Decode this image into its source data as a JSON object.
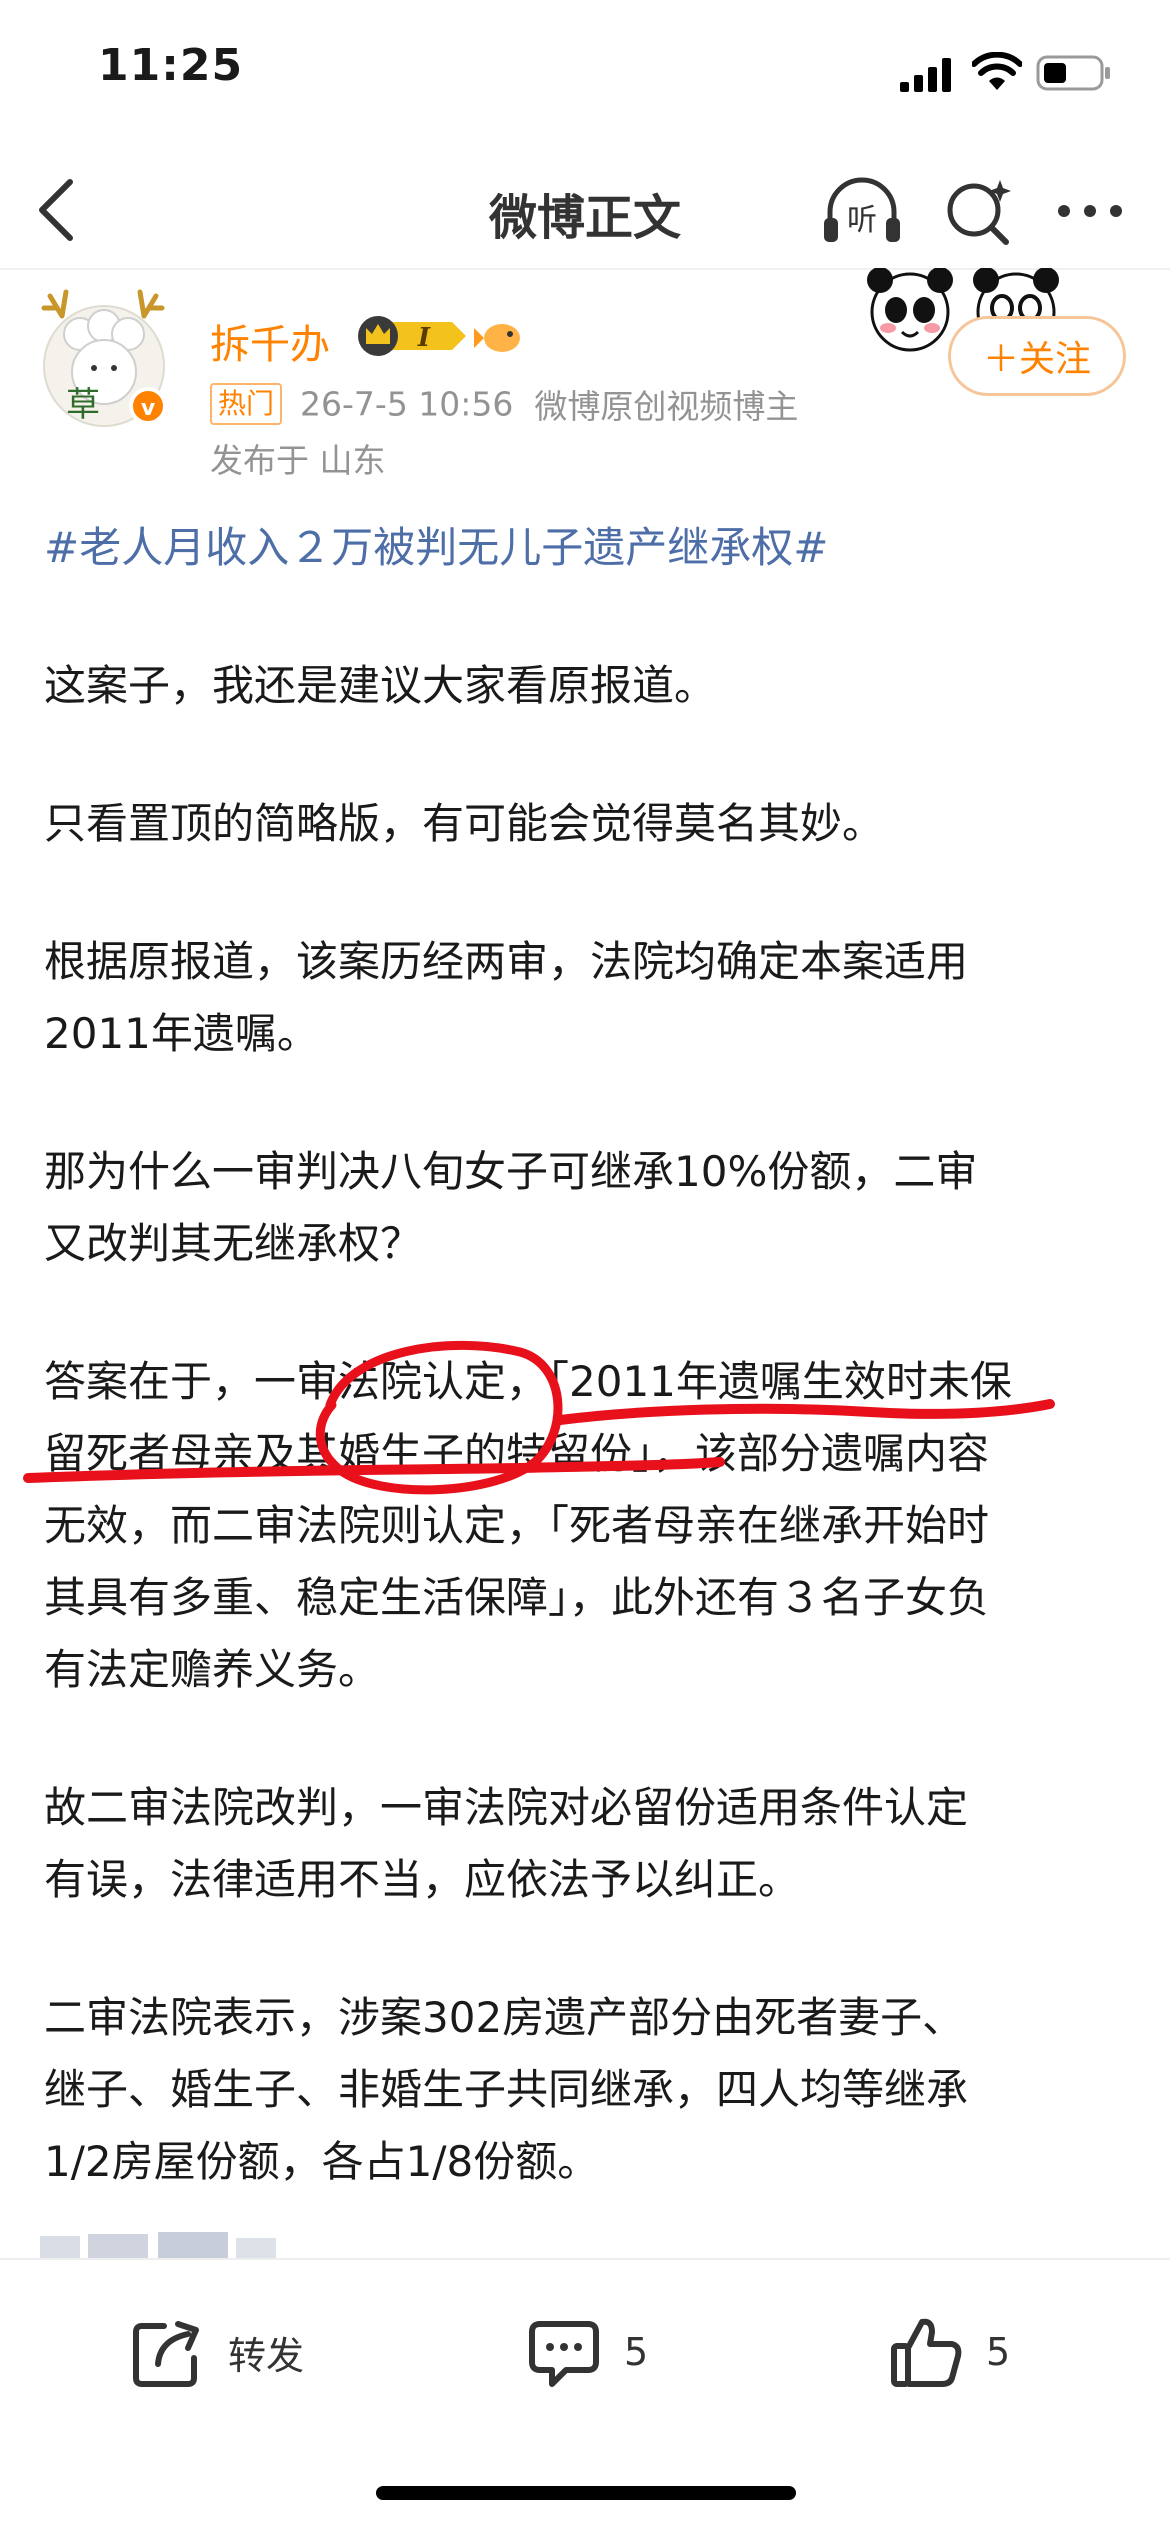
{
  "status_bar": {
    "time": "11:25"
  },
  "nav": {
    "title": "微博正文",
    "listen_icon_text": "听"
  },
  "author": {
    "name": "拆千办",
    "avatar_text": "草",
    "badge_level": "I",
    "hot_tag": "热门",
    "timestamp": "26-7-5 10:56",
    "description": "微博原创视频博主",
    "location": "发布于 山东",
    "follow_label": "＋关注"
  },
  "post": {
    "topic": "#老人月收入２万被判无儿子遗产继承权#",
    "paragraphs": [
      [
        "这案子，我还是建议大家看原报道。"
      ],
      [
        "只看置顶的简略版，有可能会觉得莫名其妙。"
      ],
      [
        "根据原报道，该案历经两审，法院均确定本案适用",
        "2011年遗嘱。"
      ],
      [
        "那为什么一审判决八旬女子可继承10%份额，二审",
        "又改判其无继承权？"
      ],
      [
        "答案在于，一审法院认定，「2011年遗嘱生效时未保",
        "留死者母亲及其婚生子的特留份」，该部分遗嘱内容",
        "无效，而二审法院则认定，「死者母亲在继承开始时",
        "其具有多重、稳定生活保障」，此外还有３名子女负",
        "有法定赡养义务。"
      ],
      [
        "故二审法院改判，一审法院对必留份适用条件认定",
        "有误，法律适用不当，应依法予以纠正。"
      ],
      [
        "二审法院表示，涉案302房遗产部分由死者妻子、",
        "继子、婚生子、非婚生子共同继承，四人均等继承",
        "1/2房屋份额，各占1/8份额。"
      ]
    ]
  },
  "actions": {
    "repost_label": "转发",
    "comment_count": "5",
    "like_count": "5"
  },
  "colors": {
    "accent": "#ff8200",
    "topic": "#4e6ea8",
    "annotation": "#e8101a"
  }
}
